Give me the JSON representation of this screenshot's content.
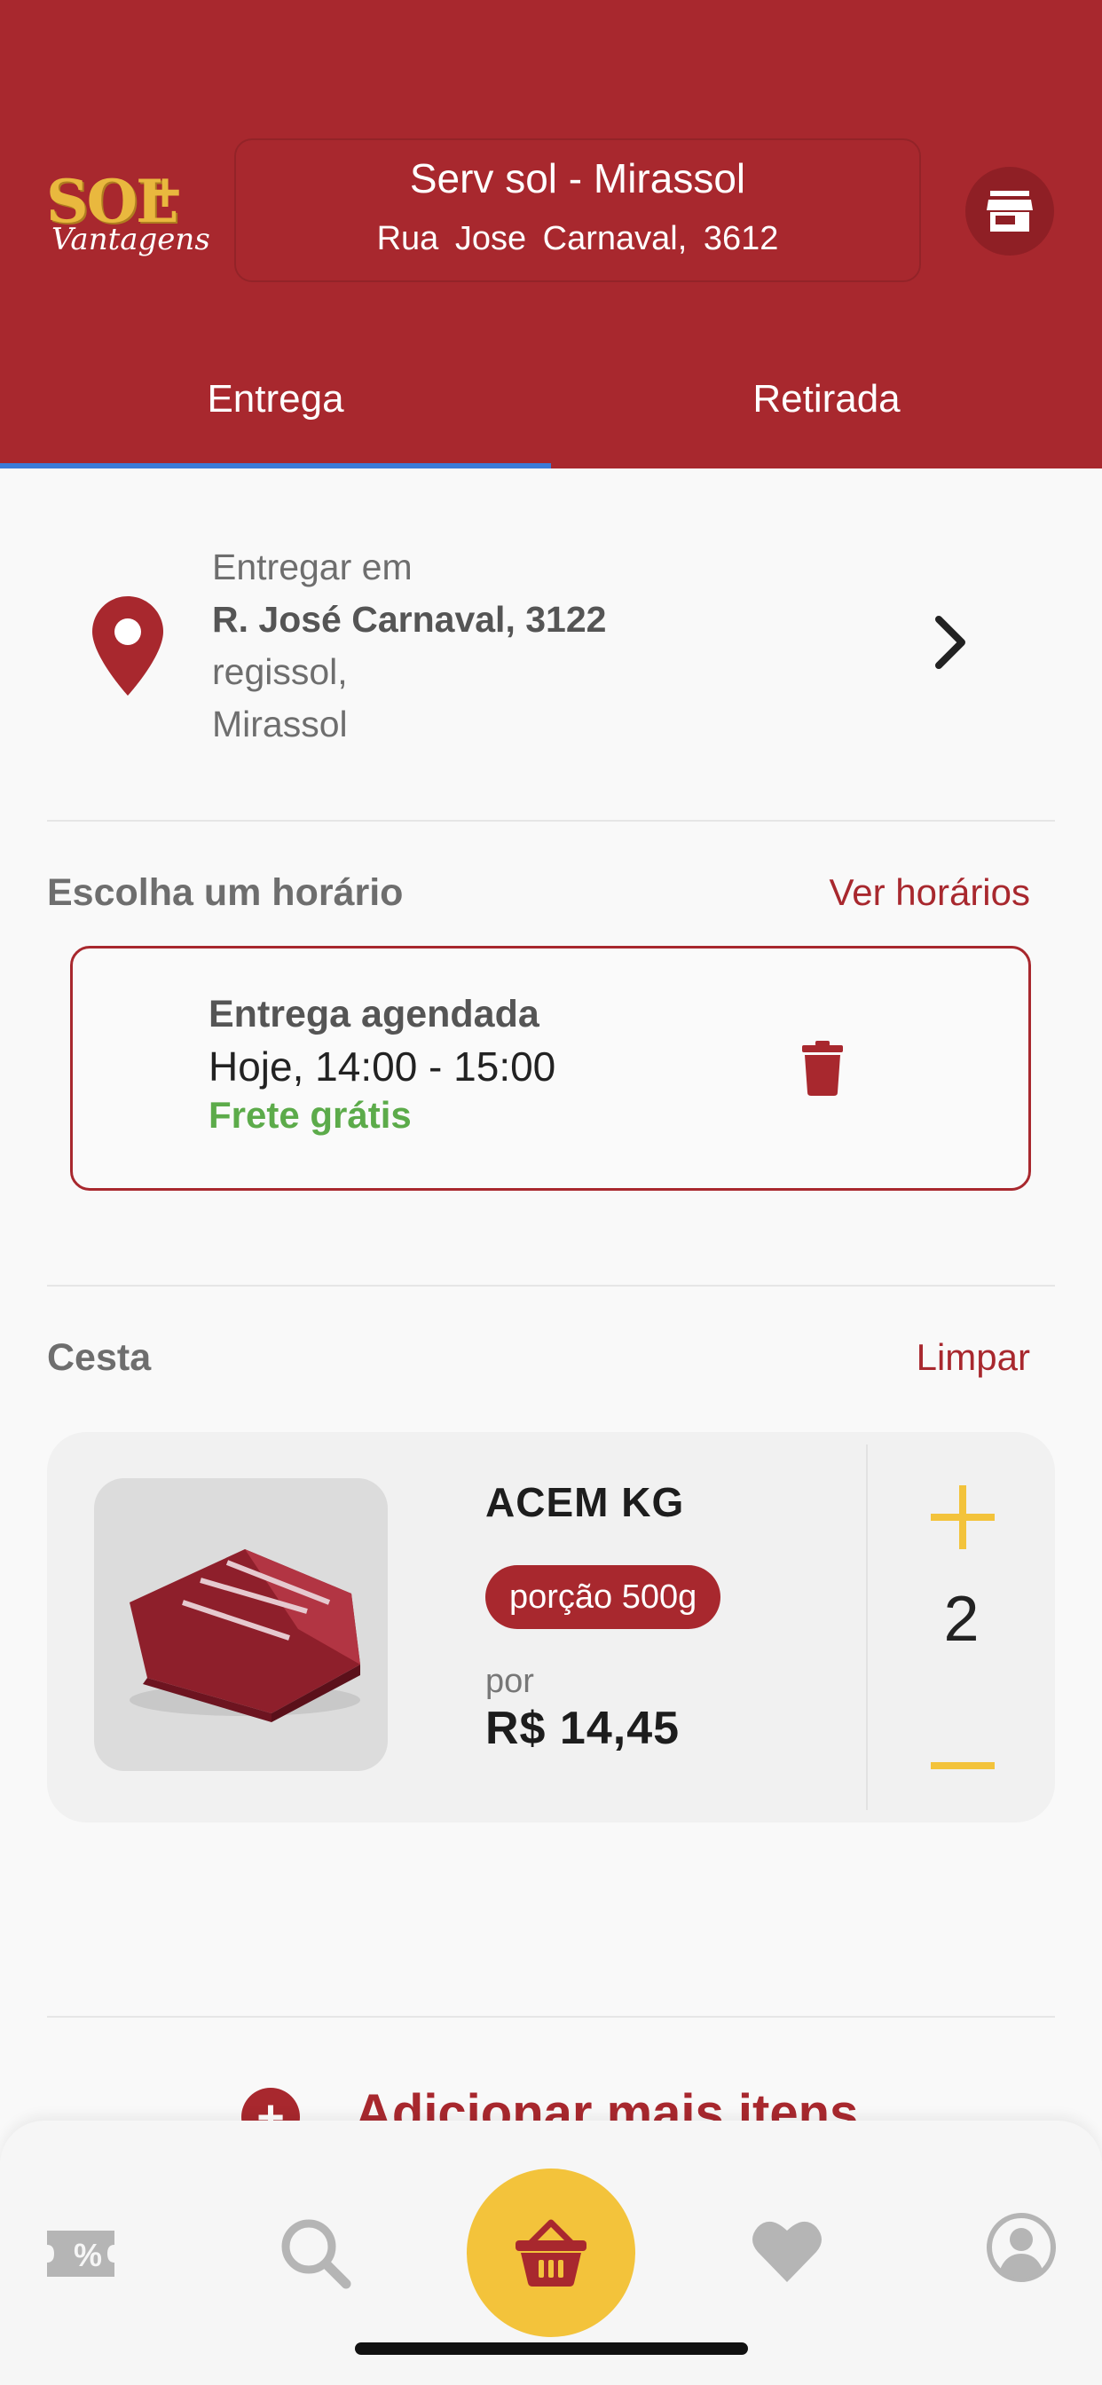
{
  "header": {
    "logo": {
      "brand": "SOL",
      "plus": "+",
      "sub": "Vantagens"
    },
    "store_name": "Serv sol - Mirassol",
    "store_address": "Rua  Jose  Carnaval, 3612",
    "store_icon": "store-icon"
  },
  "tabs": [
    {
      "label": "Entrega",
      "active": true
    },
    {
      "label": "Retirada",
      "active": false
    }
  ],
  "delivery": {
    "heading": "Entregar em",
    "street": "R. José Carnaval, 3122",
    "district": "regissol,",
    "city": "Mirassol"
  },
  "schedule": {
    "title": "Escolha um horário",
    "link": "Ver horários",
    "type": "Entrega agendada",
    "time": "Hoje, 14:00 - 15:00",
    "shipping": "Frete grátis"
  },
  "basket": {
    "title": "Cesta",
    "clear": "Limpar",
    "items": [
      {
        "name": "ACEM KG",
        "portion": "porção 500g",
        "per": "por",
        "price": "R$ 14,45",
        "quantity": "2"
      }
    ]
  },
  "add_more": "Adicionar mais itens",
  "bottom_nav": {
    "items": [
      "coupon-icon",
      "search-icon",
      "basket-icon",
      "heart-icon",
      "profile-icon"
    ],
    "coupon_text": "%"
  },
  "colors": {
    "brand_red": "#a8282e",
    "accent_yellow": "#f3c33b",
    "tab_indicator": "#3b7cd9",
    "free_shipping_green": "#5cab4a"
  }
}
